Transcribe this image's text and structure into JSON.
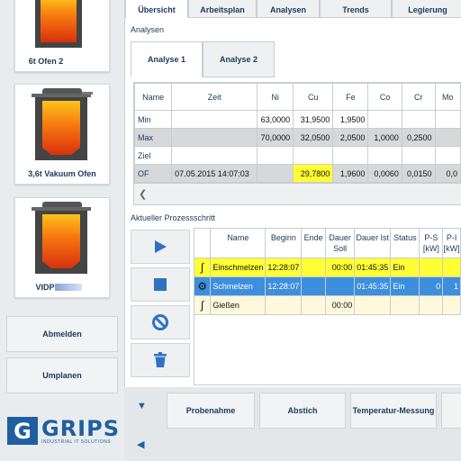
{
  "sidebar": {
    "furnaces": [
      {
        "name": "6t Ofen 2"
      },
      {
        "name": "3,6t Vakuum Ofen"
      },
      {
        "name": "VIDP"
      }
    ],
    "buttons": {
      "logout": "Abmelden",
      "rescheduling": "Umplanen"
    },
    "logo": {
      "letter": "G",
      "brand": "GRIPS",
      "tagline": "INDUSTRIAL IT SOLUTIONS"
    }
  },
  "top_tabs": [
    "Übersicht",
    "Arbeitsplan",
    "Analysen",
    "Trends",
    "Legierung"
  ],
  "analyses": {
    "section_label": "Analysen",
    "sub_tabs": [
      "Analyse 1",
      "Analyse 2"
    ],
    "columns": [
      "Name",
      "Zeit",
      "Ni",
      "Cu",
      "Fe",
      "Co",
      "Cr",
      "Mo"
    ],
    "rows": [
      {
        "cells": [
          "Min",
          "",
          "63,0000",
          "31,9500",
          "1,9500",
          "",
          "",
          ""
        ]
      },
      {
        "cells": [
          "Max",
          "",
          "70,0000",
          "32,0500",
          "2,0500",
          "1,0000",
          "0,2500",
          ""
        ]
      },
      {
        "cells": [
          "Ziel",
          "",
          "",
          "",
          "",
          "",
          "",
          ""
        ]
      },
      {
        "cells": [
          "OF",
          "07.05.2015 14:07:03",
          "",
          "29,7800",
          "1,9600",
          "0,0060",
          "0,0150",
          "0,0"
        ]
      }
    ]
  },
  "process": {
    "section_label": "Aktueller Prozessschritt",
    "columns": [
      "",
      "Name",
      "Beginn",
      "Ende",
      "Dauer Soll",
      "Dauer Ist",
      "Status",
      "P-S [kW]",
      "P-I [kW]"
    ],
    "rows": [
      {
        "icon": "∫",
        "cells": [
          "Einschmelzen",
          "12:28:07",
          "",
          "00:00",
          "01:45:35",
          "Ein",
          "",
          ""
        ]
      },
      {
        "icon": "⚙",
        "cells": [
          "Schmelzen",
          "12:28:07",
          "",
          "",
          "01:45:35",
          "Ein",
          "0",
          "1"
        ]
      },
      {
        "icon": "∫",
        "cells": [
          "Gießen",
          "",
          "",
          "00:00",
          "",
          "",
          "",
          ""
        ]
      }
    ]
  },
  "bottom_buttons": [
    "Probenahme",
    "Abstich",
    "Temperatur-Messung"
  ],
  "icons": {
    "play": "play-icon",
    "stop": "stop-icon",
    "cancel": "cancel-icon",
    "delete": "trash-icon",
    "down": "arrow-down-icon",
    "left": "arrow-left-icon"
  },
  "colors": {
    "accent": "#1f5fa0",
    "highlight_yellow": "#ffff33",
    "selection_blue": "#3d8fde"
  }
}
